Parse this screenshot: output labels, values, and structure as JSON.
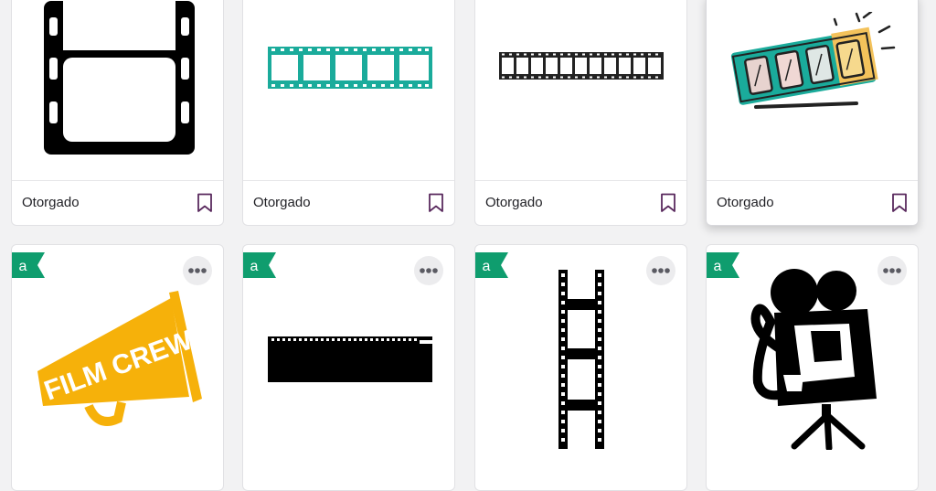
{
  "cards": [
    {
      "label": "Otorgado",
      "icon": "film-strip-vertical-large"
    },
    {
      "label": "Otorgado",
      "icon": "film-strip-teal"
    },
    {
      "label": "Otorgado",
      "icon": "film-strip-thin-horizontal"
    },
    {
      "label": "Otorgado",
      "icon": "colorful-film-strip"
    },
    {
      "badge": "a",
      "icon": "film-crew-megaphone",
      "art_text": "FILM CREW"
    },
    {
      "badge": "a",
      "icon": "black-film-strip-horizontal"
    },
    {
      "badge": "a",
      "icon": "film-strip-vertical-thin"
    },
    {
      "badge": "a",
      "icon": "film-camera-silhouette"
    }
  ],
  "colors": {
    "teal": "#1aab9b",
    "badge_green": "#0f9d6e",
    "megaphone_yellow": "#f6b10a",
    "bookmark": "#5a2a5e"
  }
}
